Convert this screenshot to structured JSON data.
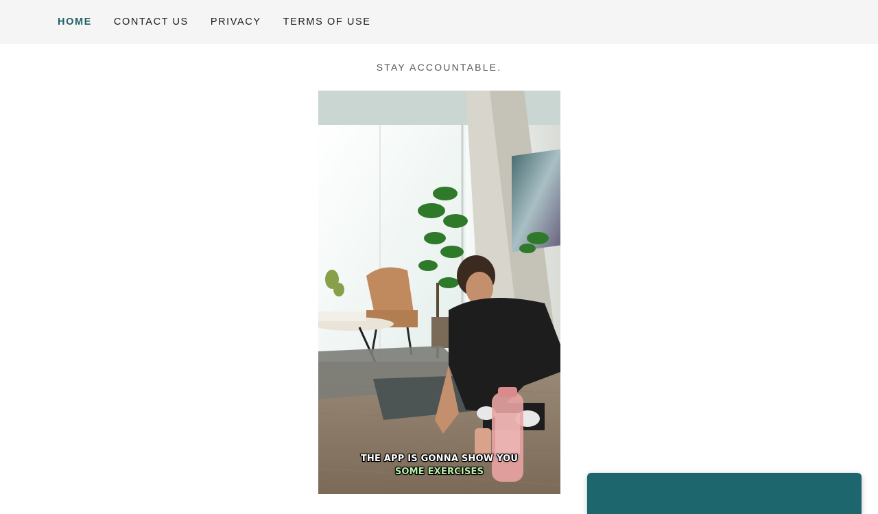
{
  "nav": {
    "items": [
      {
        "label": "HOME",
        "active": true
      },
      {
        "label": "CONTACT US",
        "active": false
      },
      {
        "label": "PRIVACY",
        "active": false
      },
      {
        "label": "TERMS OF USE",
        "active": false
      }
    ]
  },
  "main": {
    "tagline": "STAY ACCOUNTABLE.",
    "video": {
      "caption_line1": "THE APP IS GONNA SHOW YOU",
      "caption_line2": "SOME EXERCISES"
    }
  },
  "colors": {
    "accent": "#1e5f66",
    "panel": "#1e666d",
    "header_bg": "#f5f5f5"
  }
}
